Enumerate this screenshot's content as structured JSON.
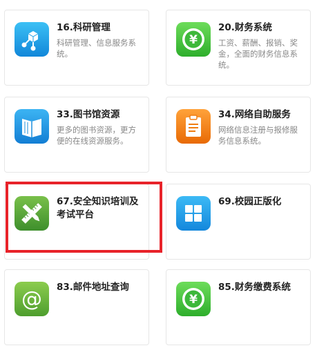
{
  "cards": [
    {
      "title": "16.科研管理",
      "desc": "科研管理、信息服务系统。",
      "icon": "cube-network-icon"
    },
    {
      "title": "20.财务系统",
      "desc": "工资、薪酬、报销、奖金，全面的财务信息系统。",
      "icon": "yuan-icon"
    },
    {
      "title": "33.图书馆资源",
      "desc": "更多的图书资源，更方便的在线资源服务。",
      "icon": "book-icon"
    },
    {
      "title": "34.网络自助服务",
      "desc": "网络信息注册与报修服务信息系统。",
      "icon": "clipboard-icon"
    },
    {
      "title": "67.安全知识培训及考试平台",
      "desc": "",
      "icon": "pencil-ruler-icon"
    },
    {
      "title": "69.校园正版化",
      "desc": "",
      "icon": "windows-grid-icon"
    },
    {
      "title": "83.邮件地址查询",
      "desc": "",
      "icon": "at-sign-icon"
    },
    {
      "title": "85.财务缴费系统",
      "desc": "",
      "icon": "yuan-icon"
    }
  ],
  "colors": {
    "highlight": "#e8232a",
    "blue": "#1ea0e8",
    "green": "#4cc64a",
    "orange": "#f07d10",
    "olive": "#5aa83a"
  }
}
